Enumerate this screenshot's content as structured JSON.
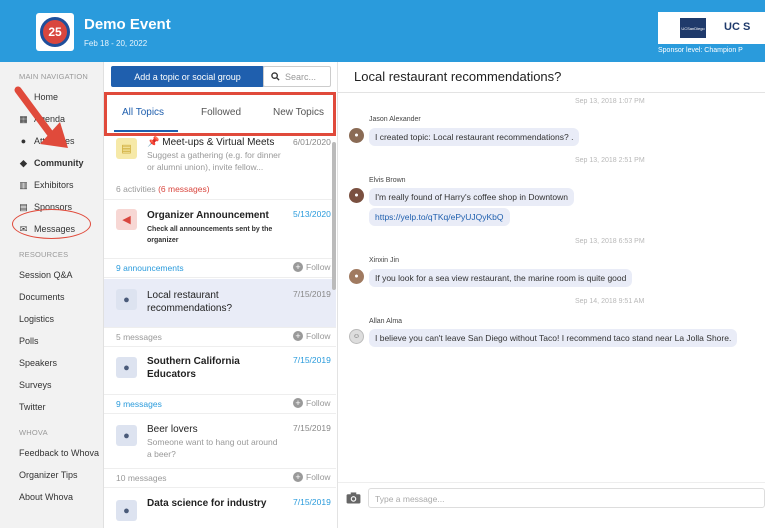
{
  "header": {
    "event_title": "Demo Event",
    "event_dates": "Feb 18 - 20, 2022",
    "logo_text": "25",
    "sponsor_name": "UC S",
    "sponsor_logo_text": "UCSanDiego",
    "sponsor_level": "Sponsor level: Champion P"
  },
  "sidebar": {
    "main_nav_label": "MAIN NAVIGATION",
    "main_items": [
      {
        "label": "Home",
        "icon": "home-icon"
      },
      {
        "label": "Agenda",
        "icon": "calendar-icon"
      },
      {
        "label": "Attendees",
        "icon": "people-icon"
      },
      {
        "label": "Community",
        "icon": "chat-icon"
      },
      {
        "label": "Exhibitors",
        "icon": "building-icon"
      },
      {
        "label": "Sponsors",
        "icon": "document-icon"
      },
      {
        "label": "Messages",
        "icon": "envelope-icon"
      }
    ],
    "resources_label": "RESOURCES",
    "resource_items": [
      "Session Q&A",
      "Documents",
      "Logistics",
      "Polls",
      "Speakers",
      "Surveys",
      "Twitter"
    ],
    "whova_label": "WHOVA",
    "whova_items": [
      "Feedback to Whova",
      "Organizer Tips",
      "About Whova"
    ]
  },
  "topics": {
    "add_button": "Add a topic or social group",
    "search_placeholder": "Searc...",
    "tabs": [
      "All Topics",
      "Followed",
      "New Topics"
    ],
    "items": [
      {
        "title": "Meet-ups & Virtual Meets",
        "desc1": "Suggest a gathering (e.g. for dinner",
        "desc2": "or alumni union), invite fellow...",
        "date": "6/01/2020",
        "meta": "6 activities",
        "meta_extra": "(6 messages)"
      },
      {
        "title": "Organizer Announcement",
        "desc1": "Check all announcements sent by the",
        "desc2": "organizer",
        "date": "5/13/2020",
        "meta": "9 announcements",
        "follow": "Follow"
      },
      {
        "title1": "Local restaurant",
        "title2": "recommendations?",
        "date": "7/15/2019",
        "meta": "5 messages",
        "follow": "Follow"
      },
      {
        "title1": "Southern California",
        "title2": "Educators",
        "date": "7/15/2019",
        "meta": "9 messages",
        "follow": "Follow"
      },
      {
        "title": "Beer lovers",
        "desc1": "Someone want to hang out around",
        "desc2": "a beer?",
        "date": "7/15/2019",
        "meta": "10 messages",
        "follow": "Follow"
      },
      {
        "title": "Data science for industry",
        "date": "7/15/2019"
      }
    ]
  },
  "chat": {
    "title": "Local restaurant recommendations?",
    "messages": [
      {
        "timestamp": "Sep 13, 2018 1:07 PM",
        "author": "Jason Alexander",
        "text": "I created topic: Local restaurant recommendations? ."
      },
      {
        "timestamp": "Sep 13, 2018 2:51 PM",
        "author": "Elvis Brown",
        "text": "I'm really found of Harry's coffee shop in Downtown",
        "link": "https://yelp.to/qTKq/ePyUJQyKbQ"
      },
      {
        "timestamp": "Sep 13, 2018 6:53 PM",
        "author": "Xinxin Jin",
        "text": "If you look for a sea view restaurant, the marine room is quite good"
      },
      {
        "timestamp": "Sep 14, 2018 9:51 AM",
        "author": "Allan Alma",
        "text": "I believe you can't leave San Diego without Taco! I recommend taco stand near La Jolla Shore."
      }
    ],
    "input_placeholder": "Type a message..."
  }
}
